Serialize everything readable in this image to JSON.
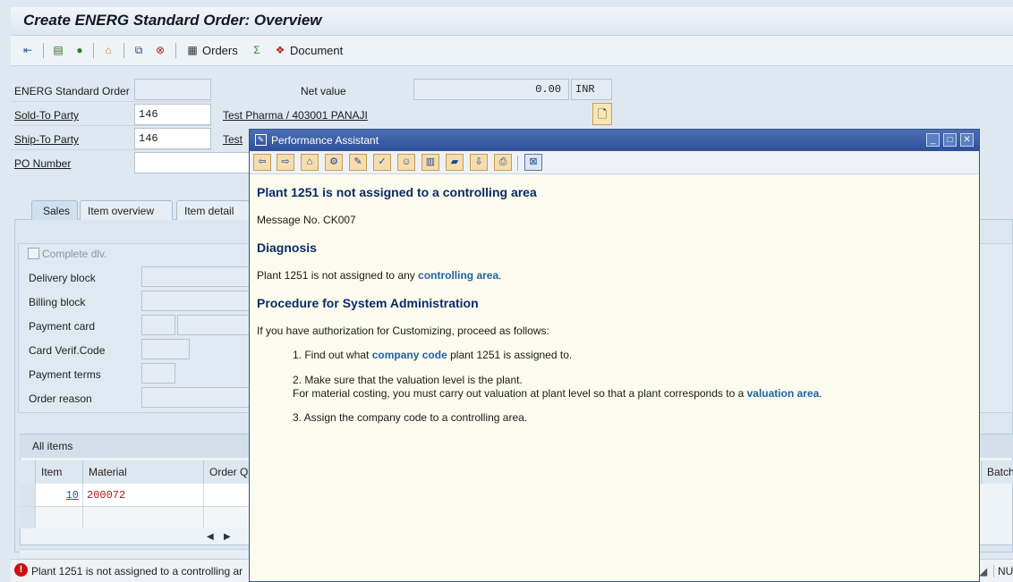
{
  "title": "Create ENERG Standard Order: Overview",
  "toolbar": {
    "orders_label": "Orders",
    "document_label": "Document"
  },
  "header": {
    "order_label": "ENERG Standard Order",
    "order_value": "",
    "net_value_label": "Net value",
    "net_value": "0.00",
    "currency": "INR",
    "sold_to_label": "Sold-To Party",
    "sold_to_value": "146",
    "sold_to_name": "Test Pharma / 403001 PANAJI",
    "ship_to_label": "Ship-To Party",
    "ship_to_value": "146",
    "ship_to_name": "Test",
    "po_label": "PO Number",
    "po_value": ""
  },
  "tabs": [
    {
      "label": "Sales"
    },
    {
      "label": "Item overview"
    },
    {
      "label": "Item detail"
    }
  ],
  "sales": {
    "complete_dlv_label": "Complete dlv.",
    "delivery_block_label": "Delivery block",
    "billing_block_label": "Billing block",
    "payment_card_label": "Payment card",
    "card_verif_label": "Card Verif.Code",
    "payment_terms_label": "Payment terms",
    "order_reason_label": "Order reason"
  },
  "items": {
    "title": "All items",
    "columns": [
      "Item",
      "Material",
      "Order Qu",
      "Batch"
    ],
    "rows": [
      {
        "item": "10",
        "material": "200072"
      }
    ]
  },
  "status": {
    "message": "Plant 1251 is not assigned to a controlling ar",
    "right_text": "NUL"
  },
  "dialog": {
    "title": "Performance Assistant",
    "heading": "Plant 1251 is not assigned to a controlling area",
    "message_no": "Message No. CK007",
    "diagnosis_heading": "Diagnosis",
    "diagnosis_text": "Plant 1251 is not assigned to any",
    "diagnosis_link": "controlling area",
    "procedure_heading": "Procedure for System Administration",
    "procedure_intro": "If you have authorization for Customizing, proceed as follows:",
    "step1_pre": "1. Find out what",
    "step1_link": "company code",
    "step1_post": "plant 1251 is assigned to.",
    "step2_line1": "2. Make sure that the valuation level is the plant.",
    "step2_line2_pre": "For material costing, you must carry out valuation at plant level so that a plant corresponds to a",
    "step2_link": "valuation area",
    "step3": "3. Assign the company code to a controlling area."
  },
  "colors": {
    "dialog_header": "#2f4f96",
    "dialog_bg": "#fcfcee",
    "link": "#1e62a6",
    "heading": "#0a2a6a",
    "error": "#cc1010"
  }
}
